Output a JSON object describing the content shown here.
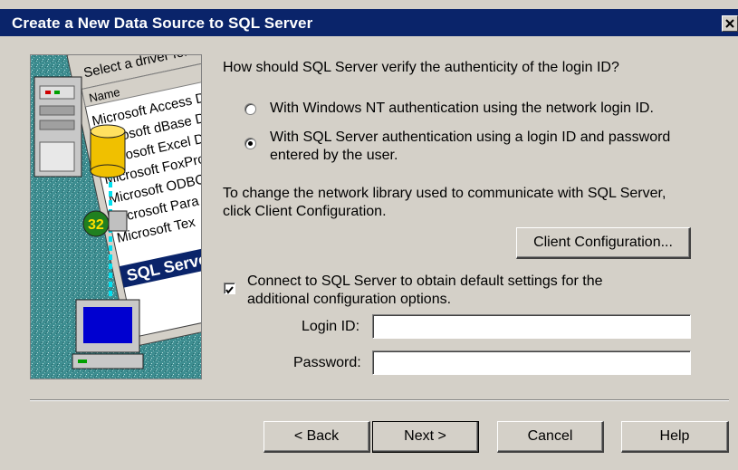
{
  "window": {
    "title": "Create a New Data Source to SQL Server",
    "close_icon": "close-icon"
  },
  "illustration": {
    "header": "Select a driver for",
    "column_label": "Name",
    "driver_list": [
      "Microsoft Access D",
      "Microsoft dBase D",
      "Microsoft Excel D",
      "Microsoft FoxPro",
      "Microsoft ODBC",
      "Microsoft Para",
      "Microsoft Tex",
      "SQL Server"
    ],
    "badge": "32"
  },
  "auth": {
    "question": "How should SQL Server verify the authenticity of the login ID?",
    "option_nt": "With Windows NT authentication using the network login ID.",
    "option_sql_line1": "With SQL Server authentication using a login ID and password",
    "option_sql_line2": "entered by the user.",
    "selected": "sql"
  },
  "network": {
    "line1": "To change the network library used to communicate with SQL Server,",
    "line2": "click Client Configuration.",
    "client_config_label": "Client Configuration..."
  },
  "connect": {
    "checked": true,
    "line1": "Connect to SQL Server to obtain default settings for the",
    "line2": "additional configuration options."
  },
  "login": {
    "label": "Login ID:",
    "value": ""
  },
  "password": {
    "label": "Password:",
    "value": ""
  },
  "buttons": {
    "back": "< Back",
    "next": "Next >",
    "cancel": "Cancel",
    "help": "Help"
  },
  "colors": {
    "titlebar": "#0a246a",
    "face": "#d4d0c8",
    "art_bg": "#3b8b8f",
    "highlight": "#0a246a"
  }
}
